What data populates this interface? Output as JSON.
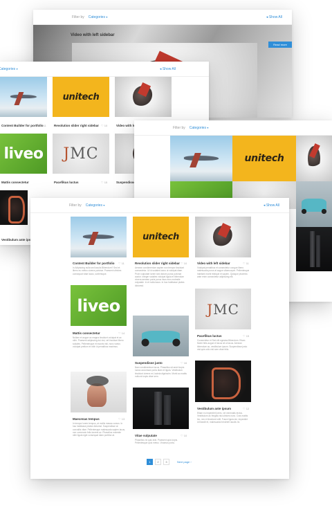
{
  "filter": {
    "label": "Filter by",
    "category": "Categories",
    "show_all": "Show All"
  },
  "video_card": {
    "title": "Video with left sidebar",
    "read_more": "Read more"
  },
  "logos": {
    "unitech": "unitech",
    "liveo": "liveo",
    "jmc_j": "J",
    "jmc_rest": "MC"
  },
  "items": [
    {
      "title": "Content Builder for portfolio",
      "likes": "11",
      "desc": "In Adipiscing nulla sed iaculis Bibendum? Sed et libero eu metus viverra pulvinar. Praesent ultricies consequat vitae lacus, scelerisque."
    },
    {
      "title": "Revolution slider right sidebar",
      "likes": "10",
      "desc": "Aenean condimentum sapien non tempor tincidunt consectetur. Ut id sodales lacus ut volutpat diam. Proin vulputate lorem sed dictum purus pulvinar auctor. Integer sodales volutpat ligula et bibendum viverra aenean porta purus risus eros molestie vulputate. In et nulla lacus. In hac habitasse platea dictumst."
    },
    {
      "title": "Video with left sidebar",
      "likes": "11",
      "desc": "Volutpat penatibus et consectetur congue libero malesuada purus at augue ullamcorper. Pellentesque habitant morbi tristique et sapien. Quisque pharetra ante enim consectetur adipiscing elit."
    },
    {
      "title": "Mattis consectetur",
      "likes": "14",
      "desc": "Nullam et augue ac magna tincidunt volutpat et ac nibh. Praesent adipiscing dui nisl, vel tincidunt libero sodales. Pellentesque et mauris nisl, nunc varius volutpat pretium et nibh id penatibus maximus."
    },
    {
      "title": "Pacefikus luctus",
      "likes": "15",
      "desc": "Consectetur et Sed elit egestas Bibendum. Etiam Morbi felis augue et lacus sit ut lacus. Aenean bibendum ac, vestibulum ipsum. Suspendisse justo nisl quis odio nisl sem vitae felis."
    },
    {
      "title": "Suspendisse justo",
      "likes": "16",
      "desc": "Nam condimentum lacus. Phasellus sit amet turpis luctus accumsan porta diam et ligula. Vestibulum tincidunt viverra mi, lacinia dignissim. Morbi ac mattis nulla at turpis vitae sem."
    },
    {
      "title": "Vestibulum ante ipsum",
      "likes": "12",
      "desc": "Etiam eu imperdiet lorem, vel venenatis lectus. Vestibulum ac fringilla nisi ultrices nunc. Cras mattis leo, nec et tincidunt velit. Fusce ligula dui, imperdiet id blandit et, malesuada hendrerit iaculis mi."
    },
    {
      "title": "Maecenas tempus",
      "likes": "13",
      "desc": "In tempor lorem tempus, at mollis massa cursus. In hac habitasse platea dictumst. Suspendisse at convallis vitae. Pellentesque malesuada sapien lacus, non commodo felis laoreet ac. Phasellus molestie nibh ligula eget consequat diam porttitor at."
    },
    {
      "title": "Vitae vulputate",
      "likes": "10",
      "desc": "Phasellus mi quis erat. Praesent quis turpis. Pellentesque quis metus. Vivamus porta."
    }
  ],
  "pagination": {
    "pages": [
      "1",
      "2",
      "3"
    ],
    "next_label": "Next page"
  }
}
